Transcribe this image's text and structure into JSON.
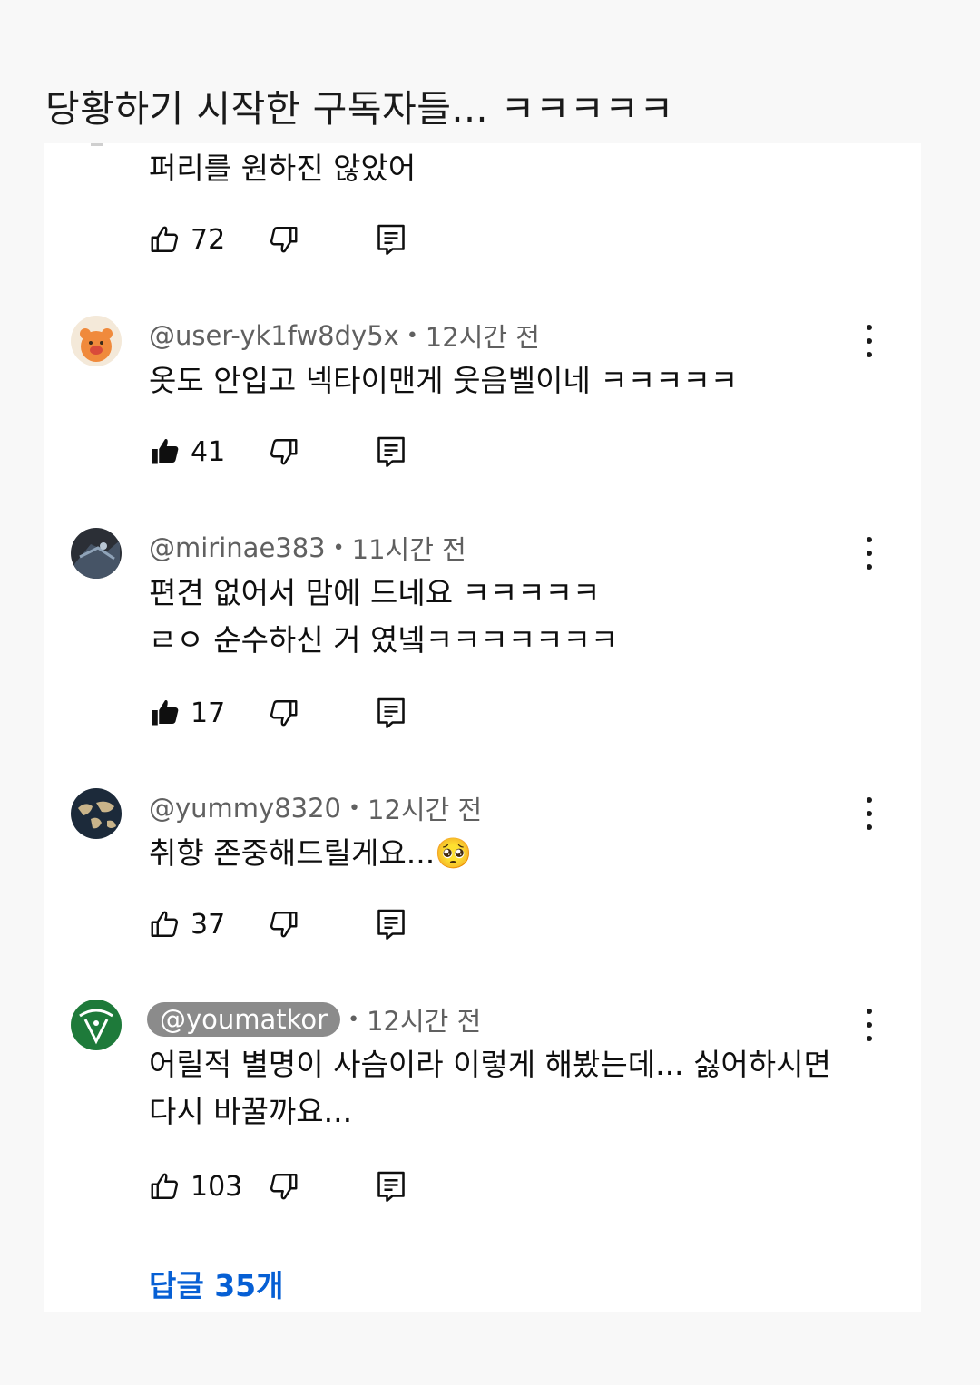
{
  "post_title": "당황하기 시작한 구독자들... ㅋㅋㅋㅋㅋ",
  "first_comment": {
    "text": "퍼리를 원하진 않았어",
    "likes": "72"
  },
  "comments": [
    {
      "author": "@user-yk1fw8dy5x",
      "time": "12시간 전",
      "text": "옷도 안입고 넥타이맨게 웃음벨이네 ㅋㅋㅋㅋㅋ",
      "likes": "41",
      "liked": true
    },
    {
      "author": "@mirinae383",
      "time": "11시간 전",
      "text": "편견 없어서 맘에 드네요 ㅋㅋㅋㅋㅋ\nㄹㅇ 순수하신 거 였넼ㅋㅋㅋㅋㅋㅋㅋ",
      "likes": "17",
      "liked": true
    },
    {
      "author": "@yummy8320",
      "time": "12시간 전",
      "text": "취향 존중해드릴게요...🥺",
      "likes": "37",
      "liked": false
    },
    {
      "author": "@youmatkor",
      "time": "12시간 전",
      "text": "어릴적 별명이 사슴이라 이렇게 해봤는데... 싫어하시면\n다시 바꿀까요...",
      "likes": "103",
      "liked": false,
      "is_channel_owner": true
    }
  ],
  "replies_link": "답글 35개",
  "separator": "•",
  "icons": {
    "like": "thumbs-up-icon",
    "like_filled": "thumbs-up-filled-icon",
    "dislike": "thumbs-down-icon",
    "reply": "reply-comment-icon",
    "more": "more-vertical-icon"
  },
  "colors": {
    "link": "#065fd4",
    "secondary_text": "#606060",
    "owner_pill": "#8b8b8b",
    "background": "#f8f8f8"
  }
}
